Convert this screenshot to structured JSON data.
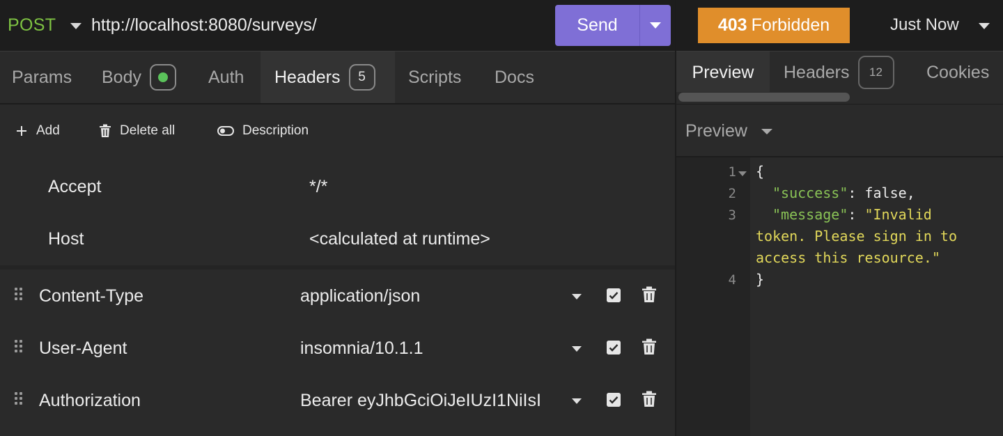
{
  "request": {
    "method": "POST",
    "url": "http://localhost:8080/surveys/",
    "send_label": "Send"
  },
  "request_tabs": [
    {
      "label": "Params"
    },
    {
      "label": "Body"
    },
    {
      "label": "Auth"
    },
    {
      "label": "Headers",
      "badge": "5"
    },
    {
      "label": "Scripts"
    },
    {
      "label": "Docs"
    }
  ],
  "toolbar": {
    "add": "Add",
    "delete_all": "Delete all",
    "description": "Description"
  },
  "default_headers": [
    {
      "name": "Accept",
      "value": "*/*"
    },
    {
      "name": "Host",
      "value": "<calculated at runtime>"
    }
  ],
  "headers": [
    {
      "name": "Content-Type",
      "value": "application/json",
      "enabled": true
    },
    {
      "name": "User-Agent",
      "value": "insomnia/10.1.1",
      "enabled": true
    },
    {
      "name": "Authorization",
      "value": "Bearer eyJhbGciOiJeIUzI1NiIsI",
      "enabled": true
    }
  ],
  "response": {
    "status_code": "403",
    "status_text": "Forbidden",
    "status_color": "#e08e2b",
    "time": "Just Now",
    "tabs": [
      {
        "label": "Preview"
      },
      {
        "label": "Headers",
        "badge": "12"
      },
      {
        "label": "Cookies"
      }
    ],
    "preview_mode": "Preview",
    "line_numbers": [
      "1",
      "2",
      "3",
      "4"
    ],
    "code": {
      "open_brace": "{",
      "success_key": "\"success\"",
      "success_val": "false",
      "message_key": "\"message\"",
      "message_line1": "\"Invalid",
      "message_line2": "token. Please sign in to",
      "message_line3": "access this resource.\"",
      "close_brace": "}"
    }
  },
  "colors": {
    "accent": "#7f6fd6",
    "method": "#7ec242",
    "json_key": "#8ac356",
    "json_string": "#e2d85a"
  }
}
